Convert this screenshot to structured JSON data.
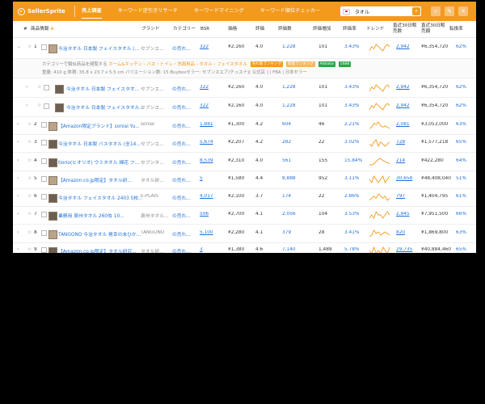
{
  "app": {
    "logo": "SellerSprite",
    "tabs": [
      "売上調査",
      "キーワード逆引きリサーチ",
      "キーワードマイニング",
      "キーワード順位チェッカー"
    ],
    "search_value": "タオル",
    "accent": "#f39a1c"
  },
  "columns": {
    "select_all": "全選択",
    "index": "#",
    "product": "商品情報",
    "brand": "ブランド",
    "category": "カテゴリー",
    "bsr": "BSR",
    "price": "価格",
    "rating": "評価",
    "reviews": "評価数",
    "reviews_added": "評価増加",
    "rating_rate": "評価率",
    "trend": "トレンド",
    "sales_30d": "直近30日販売数",
    "revenue_30d": "直近30日販売額",
    "conversion": "転換率"
  },
  "detail": {
    "line1_prefix": "カテゴリーで類似商品を閲覧する",
    "line1_path": "ホーム&キッチン › バス・トイレ・洗面用品 › タオル › フェイスタオル",
    "tag_best": "売れ筋ランキング",
    "tag_new": "新着ランキング",
    "tag_alibaba": "Alibaba",
    "tag_1688": "1688",
    "line2": "重量: 410 g  体積: 35.8 x 23.7 x 5.5 cm  バリエーション数: 15  Buyboxセラー: セブンスエア(チュスナ)[ 公式店 ] | FBA | 日本セラー"
  },
  "rows": [
    {
      "no": "1",
      "title": "今治タオル 日本製 フェイスタオル (...",
      "brand": "セブンエ...",
      "cat": "の売れ...",
      "bsr": "322",
      "price": "¥2,160",
      "rating": "4.0",
      "reviews": "1,228",
      "added": "101",
      "rate": "3.43%",
      "sales": "2,942",
      "revenue": "¥6,354,720",
      "conv": "62%"
    },
    {
      "no": "",
      "title": "今治タオル 日本製 フェイスタオ...",
      "brand": "セブンエ...",
      "cat": "の売れ...",
      "bsr": "322",
      "price": "¥2,160",
      "rating": "4.0",
      "reviews": "1,228",
      "added": "101",
      "rate": "3.43%",
      "sales": "2,942",
      "revenue": "¥6,354,720",
      "conv": "62%"
    },
    {
      "no": "",
      "title": "今治タオル 日本製 フェイスタオル...",
      "brand": "セブンエ...",
      "cat": "の売れ...",
      "bsr": "322",
      "price": "¥2,160",
      "rating": "4.0",
      "reviews": "1,228",
      "added": "101",
      "rate": "3.43%",
      "sales": "2,942",
      "revenue": "¥6,354,720",
      "conv": "62%"
    },
    {
      "no": "2",
      "title": "【Amazon限定ブランド】sonial Yu...",
      "brand": "sonial",
      "cat": "の売れ...",
      "bsr": "1,881",
      "price": "¥1,300",
      "rating": "4.2",
      "reviews": "604",
      "added": "46",
      "rate": "2.21%",
      "sales": "2,081",
      "revenue": "¥3,053,000",
      "conv": "63%"
    },
    {
      "no": "3",
      "title": "今治タオル 日本製 バスタオル (全14...",
      "brand": "セブンエ...",
      "cat": "の売れ...",
      "bsr": "5,674",
      "price": "¥2,207",
      "rating": "4.2",
      "reviews": "282",
      "added": "22",
      "rate": "3.02%",
      "sales": "728",
      "revenue": "¥1,577,218",
      "conv": "65%"
    },
    {
      "no": "4",
      "title": "tiorio(ヒオリオ) ウミタオル 綿花 フ...",
      "brand": "セブンタ...",
      "cat": "の売れ...",
      "bsr": "8,539",
      "price": "¥2,310",
      "rating": "4.0",
      "reviews": "561",
      "added": "155",
      "rate": "15.84%",
      "sales": "214",
      "revenue": "¥422,280",
      "conv": "64%"
    },
    {
      "no": "5",
      "title": "【Amazon.co.jp限定】タオル研...",
      "brand": "タオル研...",
      "cat": "の売れ...",
      "bsr": "5",
      "price": "¥1,580",
      "rating": "4.4",
      "reviews": "8,888",
      "added": "952",
      "rate": "3.11%",
      "sales": "30,658",
      "revenue": "¥48,408,040",
      "conv": "51%"
    },
    {
      "no": "6",
      "title": "今治タオル フェイスタオル 2403 5枚...",
      "brand": "E-PLAIS",
      "cat": "の売れ...",
      "bsr": "4,017",
      "price": "¥2,100",
      "rating": "3.7",
      "reviews": "174",
      "added": "22",
      "rate": "2.86%",
      "sales": "797",
      "revenue": "¥1,404,795",
      "conv": "61%"
    },
    {
      "no": "7",
      "title": "業務用 泉州タオル 260匁 10...",
      "brand": "泉州タオル...",
      "cat": "の売れ...",
      "bsr": "506",
      "price": "¥2,700",
      "rating": "4.1",
      "reviews": "2,056",
      "added": "104",
      "rate": "3.53%",
      "sales": "2,945",
      "revenue": "¥7,951,500",
      "conv": "66%"
    },
    {
      "no": "8",
      "title": "TANGONO 今治タオル 晃幸の未ひか...",
      "brand": "TANGONO",
      "cat": "の売れ...",
      "bsr": "5,100",
      "price": "¥2,280",
      "rating": "4.1",
      "reviews": "379",
      "added": "28",
      "rate": "3.41%",
      "sales": "820",
      "revenue": "¥1,869,800",
      "conv": "63%"
    },
    {
      "no": "9",
      "title": "【Amazon.co.jp限定】タオル研究...",
      "brand": "タオル研...",
      "cat": "の売れ...",
      "bsr": "3",
      "price": "¥1,380",
      "rating": "4.6",
      "reviews": "7,140",
      "added": "1,489",
      "rate": "5.78%",
      "sales": "29,735",
      "revenue": "¥40,884,460",
      "conv": "65%"
    }
  ],
  "trend_series": [
    [
      3,
      5,
      4,
      6,
      5,
      4,
      3,
      5,
      6,
      5
    ],
    [
      3,
      5,
      4,
      6,
      5,
      4,
      3,
      5,
      6,
      5
    ],
    [
      3,
      5,
      4,
      6,
      5,
      4,
      3,
      5,
      6,
      5
    ],
    [
      2,
      3,
      6,
      5,
      7,
      4,
      3,
      4,
      3,
      2
    ],
    [
      4,
      3,
      5,
      6,
      3,
      5,
      4,
      3,
      4,
      5
    ],
    [
      2,
      2,
      3,
      5,
      7,
      8,
      6,
      5,
      4,
      3
    ],
    [
      5,
      4,
      6,
      5,
      4,
      5,
      6,
      4,
      5,
      6
    ],
    [
      3,
      4,
      5,
      4,
      6,
      5,
      4,
      5,
      3,
      4
    ],
    [
      4,
      5,
      4,
      6,
      5,
      5,
      4,
      5,
      6,
      5
    ],
    [
      2,
      3,
      6,
      4,
      5,
      3,
      4,
      5,
      4,
      3
    ],
    [
      5,
      4,
      6,
      4,
      5,
      4,
      6,
      5,
      4,
      6
    ]
  ]
}
